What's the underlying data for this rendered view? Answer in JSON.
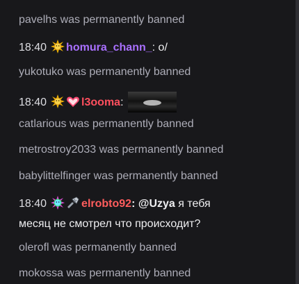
{
  "colors": {
    "background": "#18181b",
    "system_text": "#adadb8",
    "homura_chann_": "#a970ff",
    "l3ooma": "#ff4f5e",
    "elrobto92": "#ff5d5d"
  },
  "messages": [
    {
      "type": "system",
      "text": "pavelhs was permanently banned"
    },
    {
      "type": "chat",
      "time": "18:40",
      "badges": [
        "sun-emblem-icon"
      ],
      "user": "homura_chann_",
      "colon": ":",
      "text": "o/"
    },
    {
      "type": "system",
      "text": "yukotuko was permanently banned"
    },
    {
      "type": "chat",
      "time": "18:40",
      "badges": [
        "sun-emblem-icon",
        "heart-icon"
      ],
      "user": "l3ooma",
      "colon": ":",
      "emote": "dark-emote-image"
    },
    {
      "type": "system",
      "text": "catlarious was permanently banned"
    },
    {
      "type": "system",
      "text": "metrostroy2033 was permanently banned"
    },
    {
      "type": "system",
      "text": "babylittelfinger was permanently banned"
    },
    {
      "type": "chat",
      "time": "18:40",
      "badges": [
        "rainbow-emblem-icon",
        "drill-icon"
      ],
      "user": "elrobto92",
      "colon": ":",
      "mention": "@Uzya",
      "text": "я тебя",
      "text2": "месяц не смотрел что происходит?"
    },
    {
      "type": "system",
      "text": "olerofl was permanently banned"
    },
    {
      "type": "system",
      "text": "mokossa was permanently banned"
    }
  ]
}
